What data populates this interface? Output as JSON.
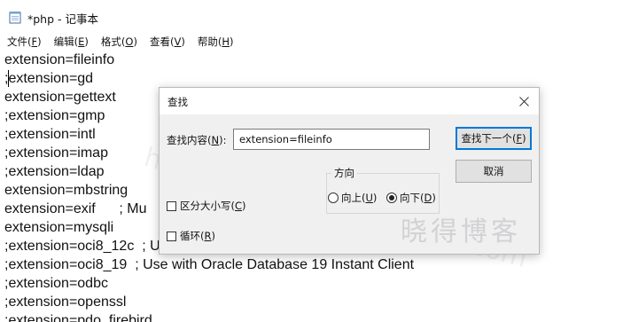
{
  "window": {
    "title": "*php - 记事本"
  },
  "menubar": [
    {
      "name": "menu-file",
      "label": "文件",
      "key": "F"
    },
    {
      "name": "menu-edit",
      "label": "编辑",
      "key": "E"
    },
    {
      "name": "menu-format",
      "label": "格式",
      "key": "O"
    },
    {
      "name": "menu-view",
      "label": "查看",
      "key": "V"
    },
    {
      "name": "menu-help",
      "label": "帮助",
      "key": "H"
    }
  ],
  "editor": {
    "lines": [
      "extension=fileinfo",
      ";extension=gd",
      "extension=gettext",
      ";extension=gmp",
      ";extension=intl",
      ";extension=imap",
      ";extension=ldap",
      "extension=mbstring",
      "extension=exif      ; Mu",
      "extension=mysqli",
      ";extension=oci8_12c  ; U",
      ";extension=oci8_19  ; Use with Oracle Database 19 Instant Client",
      ";extension=odbc",
      ";extension=openssl",
      ";extension=pdo_firebird"
    ]
  },
  "find_dialog": {
    "title": "查找",
    "find_label": "查找内容",
    "find_key": "N",
    "find_value": "extension=fileinfo",
    "find_next_button": "查找下一个",
    "find_next_key": "F",
    "cancel_button": "取消",
    "match_case_label": "区分大小写",
    "match_case_key": "C",
    "match_case_checked": false,
    "wrap_label": "循环",
    "wrap_key": "R",
    "wrap_checked": false,
    "direction_label": "方向",
    "direction_up_label": "向上",
    "direction_up_key": "U",
    "direction_down_label": "向下",
    "direction_down_key": "D",
    "direction_selected": "down"
  },
  "watermark": {
    "url": "https://www.pythonthree.com",
    "name": "晓得博客"
  }
}
